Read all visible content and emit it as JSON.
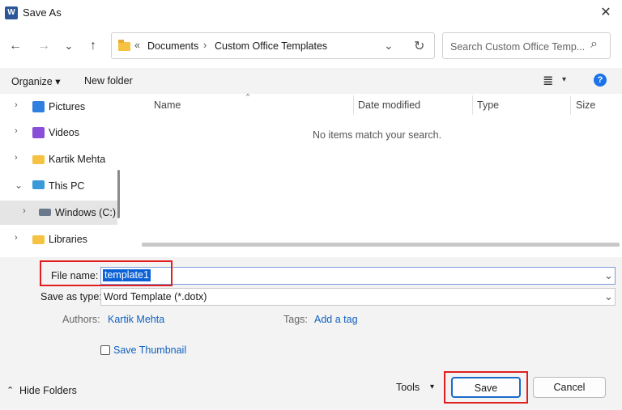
{
  "window": {
    "title": "Save As",
    "app_icon_text": "W",
    "close_glyph": "✕"
  },
  "nav": {
    "back_glyph": "←",
    "forward_glyph": "→",
    "recent_glyph": "⌄",
    "up_glyph": "↑",
    "breadcrumb_sep": "«",
    "breadcrumb": [
      "Documents",
      "Custom Office Templates"
    ],
    "path_sep": "›",
    "refresh_glyph": "↻",
    "search_placeholder": "Search Custom Office Temp...",
    "search_glyph": "⌕"
  },
  "toolbar": {
    "organize": "Organize ▾",
    "new_folder": "New folder",
    "view_glyph": "≣",
    "view_dd": "▾",
    "help": "?"
  },
  "tree": {
    "items": [
      {
        "label": "Pictures",
        "chevron": "›",
        "icon": "pictures-icon",
        "color": "#2f7fe0"
      },
      {
        "label": "Videos",
        "chevron": "›",
        "icon": "videos-icon",
        "color": "#8a4fd8"
      },
      {
        "label": "Kartik Mehta",
        "chevron": "›",
        "icon": "folder-icon",
        "color": "#f5c242"
      },
      {
        "label": "This PC",
        "chevron": "⌄",
        "icon": "computer-icon",
        "color": "#3a9ad9"
      },
      {
        "label": "Windows (C:)",
        "chevron": "›",
        "icon": "drive-icon",
        "color": "#6b7a8a"
      },
      {
        "label": "Libraries",
        "chevron": "›",
        "icon": "folder-icon",
        "color": "#f5c242"
      }
    ]
  },
  "list": {
    "columns": [
      "Name",
      "Date modified",
      "Type",
      "Size"
    ],
    "sort_glyph": "^",
    "empty_message": "No items match your search."
  },
  "form": {
    "filename_label": "File name:",
    "filename_value": "template1",
    "savetype_label": "Save as type:",
    "savetype_value": "Word Template (*.dotx)",
    "dropdown_glyph": "⌄",
    "authors_label": "Authors:",
    "authors_value": "Kartik Mehta",
    "tags_label": "Tags:",
    "tags_value": "Add a tag",
    "thumbnail_label": "Save Thumbnail"
  },
  "footer": {
    "hide_folders": "Hide Folders",
    "hide_glyph": "⌃",
    "tools": "Tools",
    "tools_dd": "▾",
    "save": "Save",
    "cancel": "Cancel"
  },
  "colors": {
    "accent": "#1b6ac9",
    "highlight": "#e01e1e",
    "selection": "#0b62d6"
  }
}
